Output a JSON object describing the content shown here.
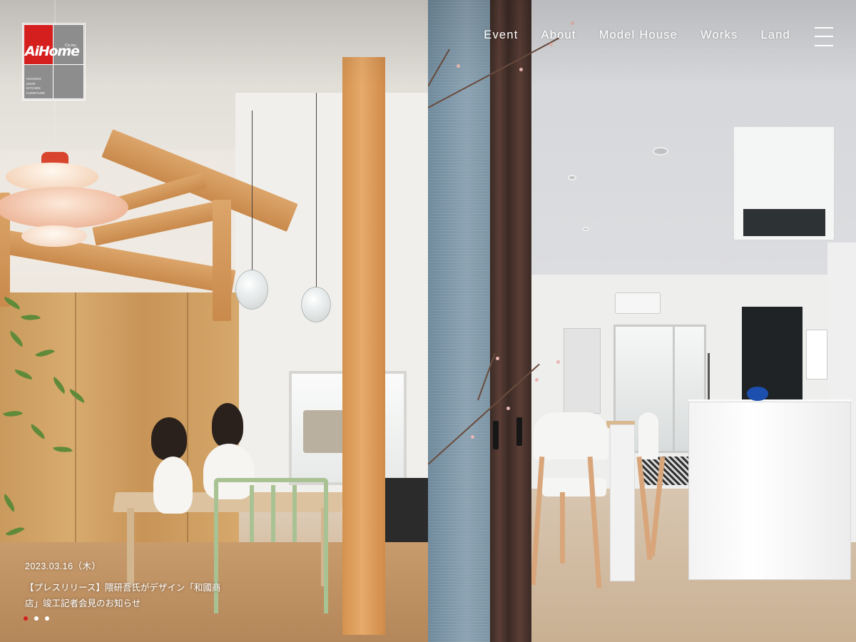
{
  "brand": {
    "logo_text": "AiHome",
    "logo_coinc": "Co.inc.",
    "logo_tags": [
      "HOUSING",
      "SHOP",
      "KITCHEN",
      "FURNITURE"
    ],
    "logo_red": "#d51f1f"
  },
  "nav": {
    "items": [
      {
        "label": "Event"
      },
      {
        "label": "About"
      },
      {
        "label": "Model House"
      },
      {
        "label": "Works"
      },
      {
        "label": "Land"
      }
    ],
    "menu_icon": "hamburger-icon"
  },
  "news": {
    "date": "2023.03.16（木）",
    "title": "【プレスリリース】隈研吾氏がデザイン「和國商店」竣工記者会見のお知らせ"
  },
  "slider": {
    "dot_count": 3,
    "active_index": 0,
    "active_color": "#d51f1f"
  }
}
